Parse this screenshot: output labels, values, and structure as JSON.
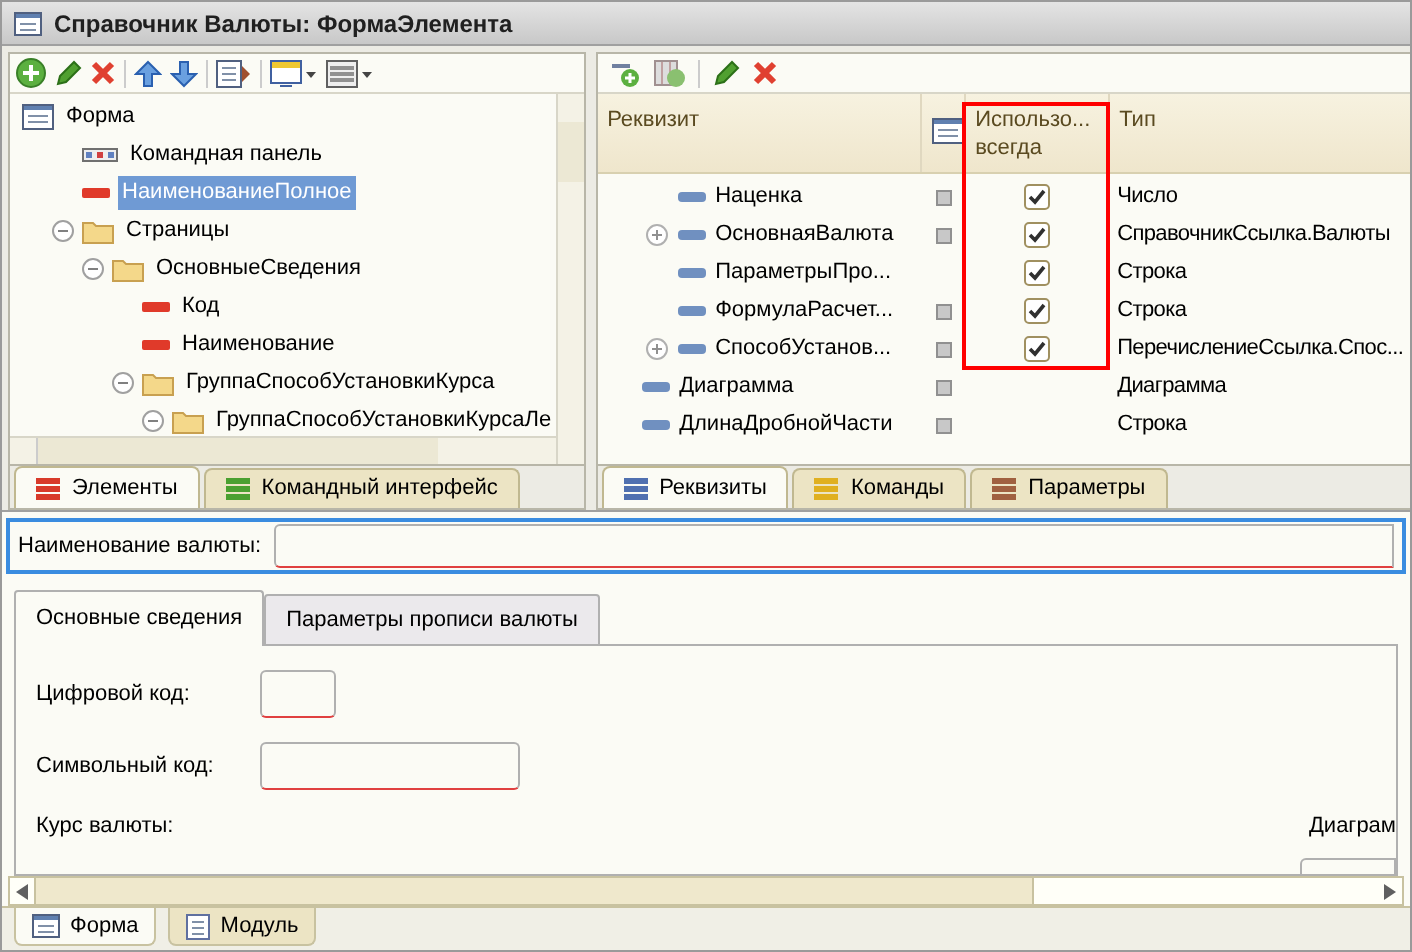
{
  "window": {
    "title": "Справочник Валюты: ФормаЭлемента"
  },
  "elements_panel": {
    "tree": [
      {
        "label": "Форма",
        "kind": "form",
        "selected": false,
        "children": [
          {
            "label": "Командная панель",
            "kind": "command-bar",
            "selected": false
          },
          {
            "label": "НаименованиеПолное",
            "kind": "field",
            "selected": true
          },
          {
            "label": "Страницы",
            "kind": "group",
            "selected": false,
            "expanded": true,
            "children": [
              {
                "label": "ОсновныеСведения",
                "kind": "group",
                "selected": false,
                "expanded": true,
                "children": [
                  {
                    "label": "Код",
                    "kind": "field",
                    "selected": false
                  },
                  {
                    "label": "Наименование",
                    "kind": "field",
                    "selected": false
                  },
                  {
                    "label": "ГруппаСпособУстановкиКурса",
                    "kind": "group",
                    "selected": false,
                    "expanded": true,
                    "children": [
                      {
                        "label": "ГруппаСпособУстановкиКурсаЛе",
                        "kind": "group",
                        "selected": false,
                        "expanded": true
                      }
                    ]
                  }
                ]
              }
            ]
          }
        ]
      }
    ],
    "tabs": [
      {
        "label": "Элементы",
        "color": "#d83a2a",
        "selected": true
      },
      {
        "label": "Командный интерфейс",
        "color": "#4aa030",
        "selected": false
      }
    ]
  },
  "attributes_panel": {
    "columns": [
      {
        "label": "Реквизит"
      },
      {
        "kind": "icon"
      },
      {
        "label": "Использо... всегда",
        "highlighted": true
      },
      {
        "label": "Тип"
      }
    ],
    "rows": [
      {
        "children": [
          {
            "name": "Наценка",
            "expandable": false,
            "marker": true,
            "use_always": true,
            "type": "Число"
          },
          {
            "name": "ОсновнаяВалюта",
            "expandable": true,
            "marker": true,
            "use_always": true,
            "type": "СправочникСсылка.Валюты"
          },
          {
            "name": "ПараметрыПро...",
            "expandable": false,
            "marker": false,
            "use_always": true,
            "type": "Строка"
          },
          {
            "name": "ФормулаРасчет...",
            "expandable": false,
            "marker": true,
            "use_always": true,
            "type": "Строка"
          },
          {
            "name": "СпособУстанов...",
            "expandable": true,
            "marker": true,
            "use_always": true,
            "type": "ПеречислениеСсылка.Спос..."
          }
        ]
      },
      {
        "name": "Диаграмма",
        "expandable": false,
        "marker": true,
        "type": "Диаграмма"
      },
      {
        "name": "ДлинаДробнойЧасти",
        "expandable": false,
        "marker": true,
        "type": "Строка"
      }
    ],
    "tabs": [
      {
        "label": "Реквизиты",
        "color": "#5070b0",
        "selected": true
      },
      {
        "label": "Команды",
        "color": "#e0b020",
        "selected": false
      },
      {
        "label": "Параметры",
        "color": "#a06040",
        "selected": false
      }
    ]
  },
  "form_preview": {
    "name_field": {
      "label": "Наименование валюты:"
    },
    "tabs": [
      {
        "label": "Основные сведения",
        "selected": true
      },
      {
        "label": "Параметры прописи валюты",
        "selected": false
      }
    ],
    "fields": [
      {
        "label": "Цифровой код:"
      },
      {
        "label": "Символьный код:"
      }
    ],
    "section_label": "Курс валюты:",
    "right_label": "Диаграм"
  },
  "bottom_tabs": [
    {
      "label": "Форма",
      "kind": "form",
      "selected": true
    },
    {
      "label": "Модуль",
      "kind": "module",
      "selected": false
    }
  ]
}
